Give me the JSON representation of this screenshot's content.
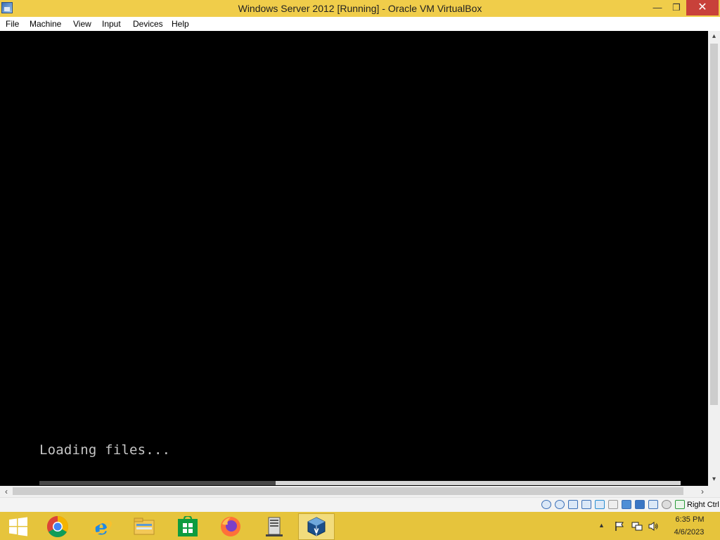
{
  "window": {
    "title": "Windows Server 2012 [Running] - Oracle VM VirtualBox",
    "minimize": "—",
    "maximize": "❐",
    "close": "✕"
  },
  "menu": [
    "File",
    "Machine",
    "View",
    "Input",
    "Devices",
    "Help"
  ],
  "vm_screen": {
    "text": "Loading files..."
  },
  "scroll": {
    "up": "▴",
    "down": "▾",
    "left": "‹",
    "right": "›"
  },
  "statusbar": {
    "icons": [
      "hard-disk-icon",
      "optical-drive-icon",
      "audio-icon",
      "network-icon",
      "usb-icon",
      "shared-folders-icon",
      "display-icon",
      "video-capture-icon",
      "cpu-icon",
      "mouse-integration-icon",
      "arrow-icon",
      "keyboard-capture-icon"
    ],
    "host_key": "Right Ctrl"
  },
  "taskbar": {
    "apps": [
      "start",
      "chrome",
      "internet-explorer",
      "file-explorer",
      "store",
      "firefox",
      "server-manager",
      "virtualbox"
    ],
    "tray_up": "▲",
    "time": "6:35 PM",
    "date": "4/6/2023"
  },
  "colors": {
    "titlebar": "#f0cd4a",
    "taskbar": "#e6c43c",
    "close_button": "#c8413a",
    "vm_background": "#000000"
  }
}
